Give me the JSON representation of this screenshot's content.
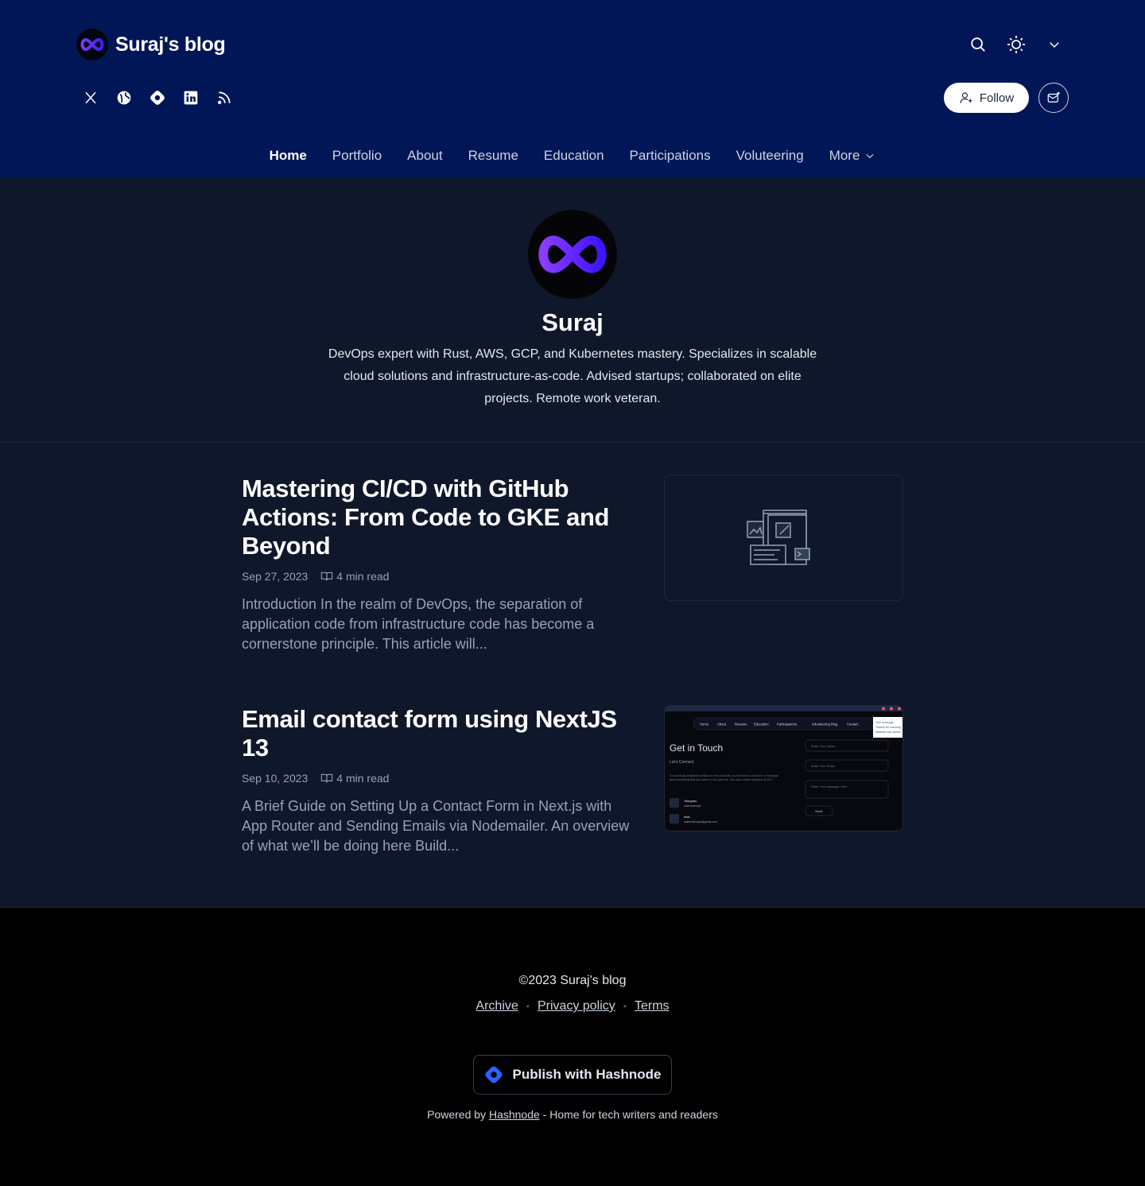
{
  "header": {
    "blog_title": "Suraj's blog",
    "follow_label": "Follow",
    "socials": [
      "x-twitter-icon",
      "globe-icon",
      "hashnode-icon",
      "linkedin-icon",
      "rss-icon"
    ],
    "nav": [
      {
        "label": "Home",
        "active": true
      },
      {
        "label": "Portfolio"
      },
      {
        "label": "About"
      },
      {
        "label": "Resume"
      },
      {
        "label": "Education"
      },
      {
        "label": "Participations"
      },
      {
        "label": "Voluteering"
      },
      {
        "label": "More"
      }
    ],
    "bg_color": "#001656"
  },
  "profile": {
    "name": "Suraj",
    "bio": "DevOps expert with Rust, AWS, GCP, and Kubernetes mastery. Specializes in scalable cloud solutions and infrastructure-as-code. Advised startups; collaborated on elite projects. Remote work veteran."
  },
  "posts": [
    {
      "title": "Mastering CI/CD with GitHub Actions: From Code to GKE and Beyond",
      "date": "Sep 27, 2023",
      "read_time": "4 min read",
      "excerpt": "Introduction In the realm of DevOps, the separation of application code from infrastructure code has become a cornerstone principle. This article will..."
    },
    {
      "title": "Email contact form using NextJS 13",
      "date": "Sep 10, 2023",
      "read_time": "4 min read",
      "excerpt": "A Brief Guide on Setting Up a Contact Form in Next.js with App Router and Sending Emails via Nodemailer. An overview of what we’ll be doing here Build...",
      "cover": {
        "nav": [
          "Home",
          "About",
          "Resume",
          "Education",
          "Participations",
          "volunteering",
          "Blog",
          "Contact"
        ],
        "heading": "Get in Touch",
        "subheading": "Let's Connect",
        "paragraph": "I'm currently available to take on new projects, so feel free to send me a message about anything that you want to run past me. You can contact anytime at 24/7",
        "telegram_label": "Telegram",
        "telegram_value": "callmedevops",
        "mail_label": "Mail",
        "mail_value": "callmedevops@gmail.com",
        "name_placeholder": "Enter Your Name",
        "email_placeholder": "Enter Your Email",
        "message_placeholder": "Write Your Message Here...",
        "send_label": "Send",
        "toast_line1": "Your message",
        "toast_line2": "Thanks for reaching",
        "toast_line3": "fantastic day ahead"
      }
    }
  ],
  "footer": {
    "copyright": "©2023 Suraj's blog",
    "links": [
      "Archive",
      "Privacy policy",
      "Terms"
    ],
    "publish_label": "Publish with Hashnode",
    "powered_prefix": "Powered by",
    "powered_link": "Hashnode",
    "powered_suffix": "- Home for tech writers and readers"
  }
}
